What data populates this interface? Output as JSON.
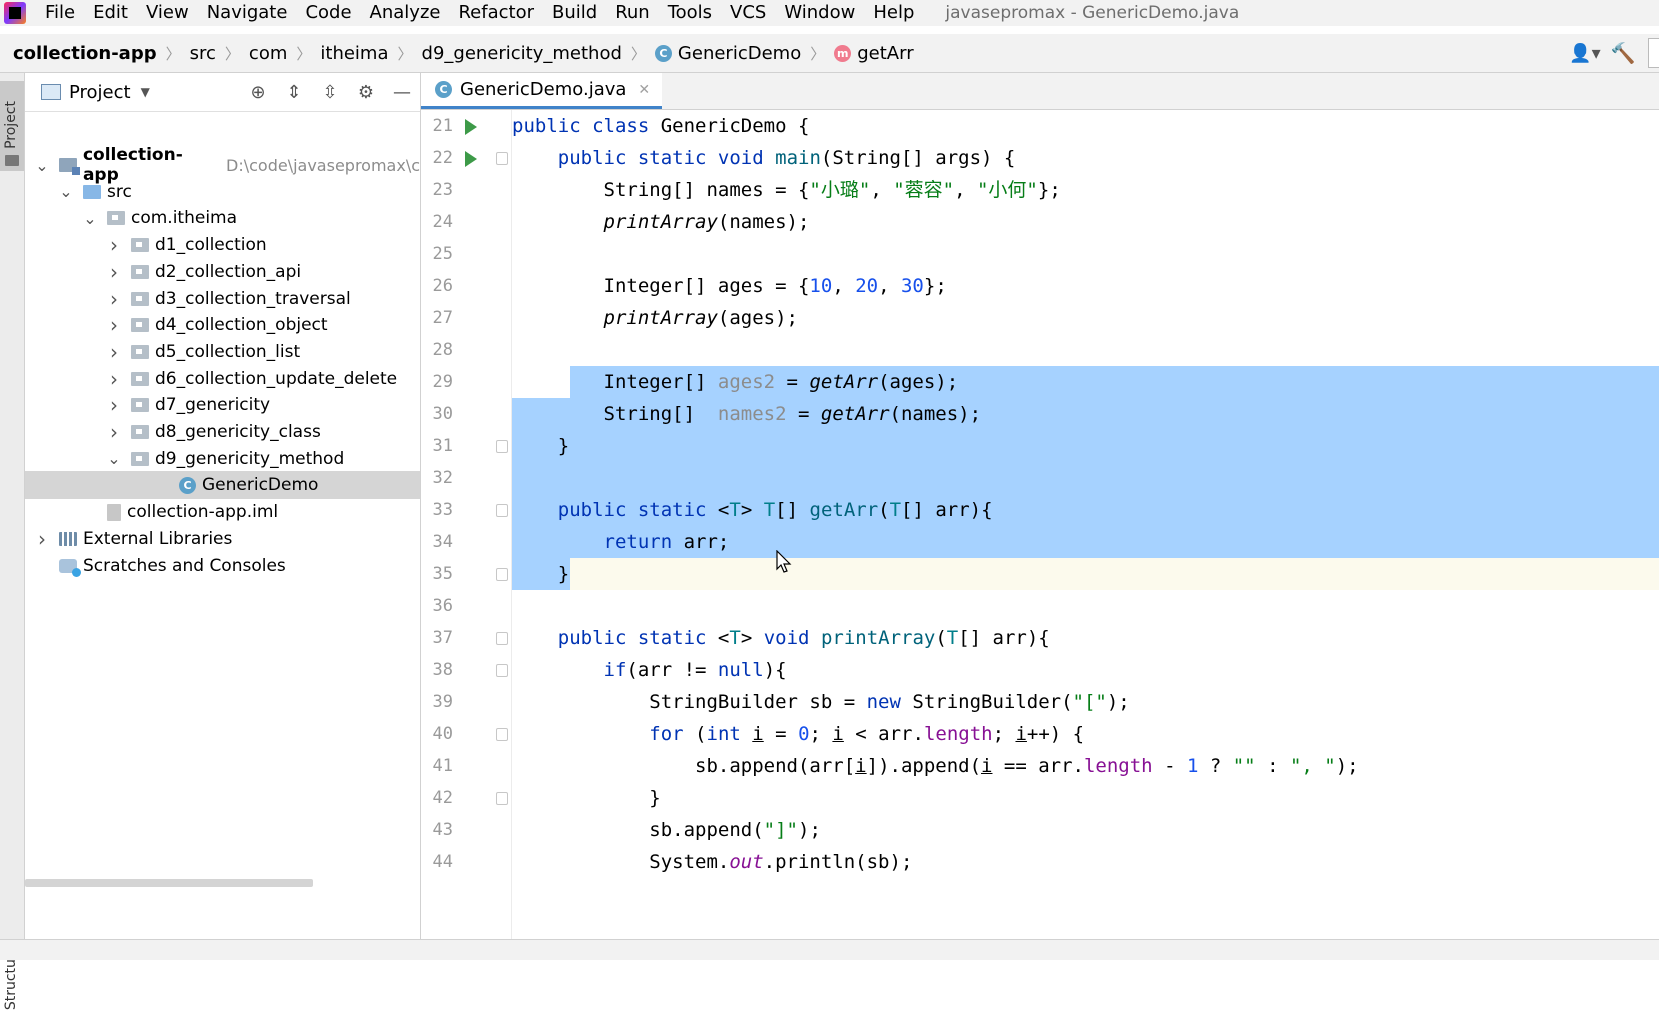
{
  "menu": {
    "items": [
      "File",
      "Edit",
      "View",
      "Navigate",
      "Code",
      "Analyze",
      "Refactor",
      "Build",
      "Run",
      "Tools",
      "VCS",
      "Window",
      "Help"
    ],
    "window_title": "javasepromax - GenericDemo.java"
  },
  "breadcrumb": {
    "items": [
      "collection-app",
      "src",
      "com",
      "itheima",
      "d9_genericity_method",
      "GenericDemo",
      "getArr"
    ]
  },
  "project_panel": {
    "title": "Project",
    "tree": [
      {
        "label": "collection-app",
        "path": "D:\\code\\javasepromax\\c",
        "depth": 0,
        "expanded": true,
        "icon": "module-icon",
        "bold": true
      },
      {
        "label": "src",
        "depth": 1,
        "expanded": true,
        "icon": "source-folder-icon"
      },
      {
        "label": "com.itheima",
        "depth": 2,
        "expanded": true,
        "icon": "package-icon"
      },
      {
        "label": "d1_collection",
        "depth": 3,
        "expanded": false,
        "icon": "package-icon"
      },
      {
        "label": "d2_collection_api",
        "depth": 3,
        "expanded": false,
        "icon": "package-icon"
      },
      {
        "label": "d3_collection_traversal",
        "depth": 3,
        "expanded": false,
        "icon": "package-icon"
      },
      {
        "label": "d4_collection_object",
        "depth": 3,
        "expanded": false,
        "icon": "package-icon"
      },
      {
        "label": "d5_collection_list",
        "depth": 3,
        "expanded": false,
        "icon": "package-icon"
      },
      {
        "label": "d6_collection_update_delete",
        "depth": 3,
        "expanded": false,
        "icon": "package-icon"
      },
      {
        "label": "d7_genericity",
        "depth": 3,
        "expanded": false,
        "icon": "package-icon"
      },
      {
        "label": "d8_genericity_class",
        "depth": 3,
        "expanded": false,
        "icon": "package-icon"
      },
      {
        "label": "d9_genericity_method",
        "depth": 3,
        "expanded": true,
        "icon": "package-icon"
      },
      {
        "label": "GenericDemo",
        "depth": 4,
        "icon": "java-class-icon",
        "selected": true
      },
      {
        "label": "collection-app.iml",
        "depth": 2,
        "icon": "iml-file-icon"
      },
      {
        "label": "External Libraries",
        "depth": 0,
        "expanded": false,
        "icon": "libraries-icon"
      },
      {
        "label": "Scratches and Consoles",
        "depth": 0,
        "icon": "scratches-icon"
      }
    ]
  },
  "editor": {
    "tab_label": "GenericDemo.java",
    "lines": [
      {
        "n": "21",
        "run": true
      },
      {
        "n": "22",
        "run": true,
        "fold": true
      },
      {
        "n": "23"
      },
      {
        "n": "24"
      },
      {
        "n": "25"
      },
      {
        "n": "26"
      },
      {
        "n": "27"
      },
      {
        "n": "28"
      },
      {
        "n": "29"
      },
      {
        "n": "30"
      },
      {
        "n": "31",
        "fold": true
      },
      {
        "n": "32"
      },
      {
        "n": "33",
        "fold": true
      },
      {
        "n": "34"
      },
      {
        "n": "35",
        "fold": true
      },
      {
        "n": "36"
      },
      {
        "n": "37",
        "fold": true
      },
      {
        "n": "38",
        "fold": true
      },
      {
        "n": "39"
      },
      {
        "n": "40",
        "fold": true
      },
      {
        "n": "41"
      },
      {
        "n": "42",
        "fold": true
      },
      {
        "n": "43"
      },
      {
        "n": "44"
      }
    ]
  },
  "tool_stripe": {
    "project_label": "Project",
    "structure_label": "Structure"
  },
  "colors": {
    "selection": "#a6d2ff",
    "keyword": "#0033b3",
    "string": "#067d17",
    "number": "#1750eb",
    "accent": "#4083c9"
  }
}
